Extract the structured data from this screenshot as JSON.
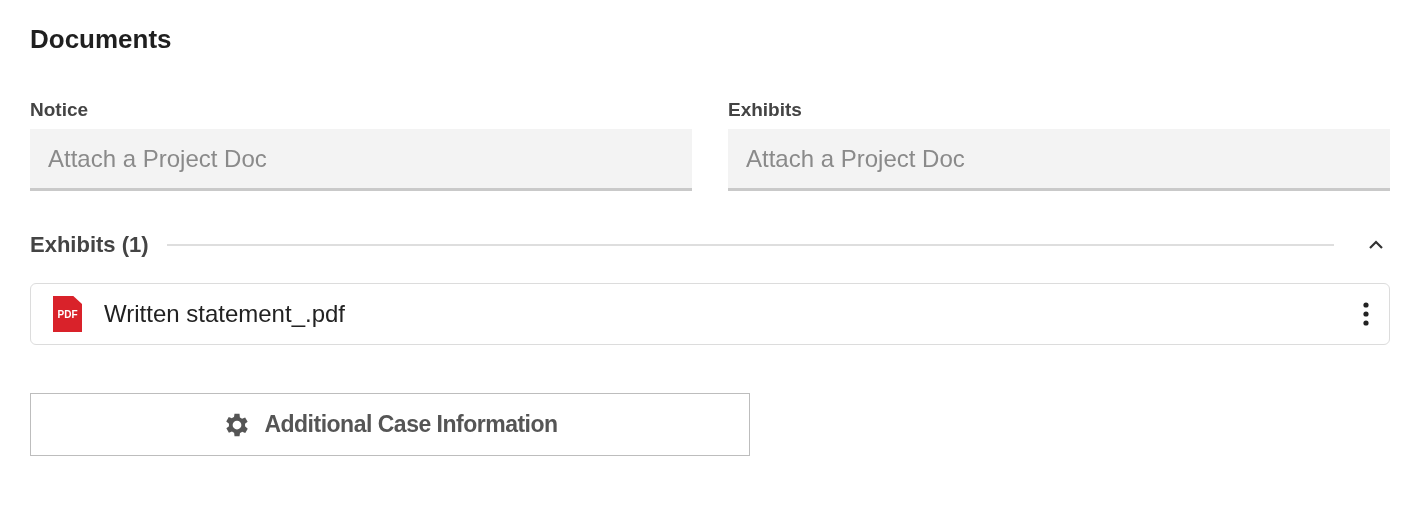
{
  "title": "Documents",
  "fields": [
    {
      "label": "Notice",
      "placeholder": "Attach a Project Doc"
    },
    {
      "label": "Exhibits",
      "placeholder": "Attach a Project Doc"
    }
  ],
  "section": {
    "title": "Exhibits (1)",
    "expanded": true,
    "files": [
      {
        "type": "PDF",
        "name": "Written statement_.pdf"
      }
    ]
  },
  "button": {
    "label": "Additional Case Information"
  }
}
